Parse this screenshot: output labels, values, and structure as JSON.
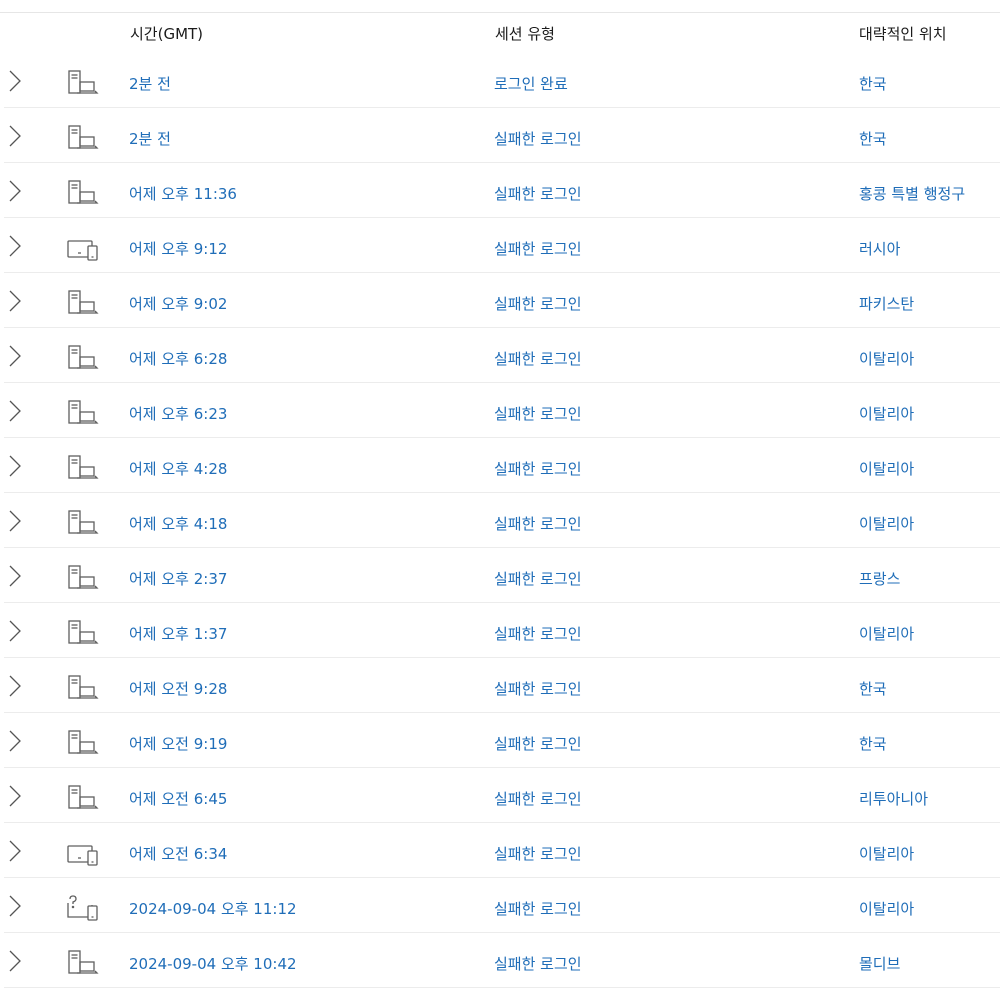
{
  "columns": {
    "time": "시간(GMT)",
    "session_type": "세션 유형",
    "location": "대략적인 위치"
  },
  "colors": {
    "link": "#1f6db8",
    "icon": "#5f5f5f",
    "divider": "#ececec"
  },
  "rows": [
    {
      "device_icon": "desktop-laptop-icon",
      "time": "2분 전",
      "session_type": "로그인 완료",
      "location": "한국"
    },
    {
      "device_icon": "desktop-laptop-icon",
      "time": "2분 전",
      "session_type": "실패한 로그인",
      "location": "한국"
    },
    {
      "device_icon": "desktop-laptop-icon",
      "time": "어제 오후 11:36",
      "session_type": "실패한 로그인",
      "location": "홍콩 특별 행정구"
    },
    {
      "device_icon": "tablet-phone-icon",
      "time": "어제 오후 9:12",
      "session_type": "실패한 로그인",
      "location": "러시아"
    },
    {
      "device_icon": "desktop-laptop-icon",
      "time": "어제 오후 9:02",
      "session_type": "실패한 로그인",
      "location": "파키스탄"
    },
    {
      "device_icon": "desktop-laptop-icon",
      "time": "어제 오후 6:28",
      "session_type": "실패한 로그인",
      "location": "이탈리아"
    },
    {
      "device_icon": "desktop-laptop-icon",
      "time": "어제 오후 6:23",
      "session_type": "실패한 로그인",
      "location": "이탈리아"
    },
    {
      "device_icon": "desktop-laptop-icon",
      "time": "어제 오후 4:28",
      "session_type": "실패한 로그인",
      "location": "이탈리아"
    },
    {
      "device_icon": "desktop-laptop-icon",
      "time": "어제 오후 4:18",
      "session_type": "실패한 로그인",
      "location": "이탈리아"
    },
    {
      "device_icon": "desktop-laptop-icon",
      "time": "어제 오후 2:37",
      "session_type": "실패한 로그인",
      "location": "프랑스"
    },
    {
      "device_icon": "desktop-laptop-icon",
      "time": "어제 오후 1:37",
      "session_type": "실패한 로그인",
      "location": "이탈리아"
    },
    {
      "device_icon": "desktop-laptop-icon",
      "time": "어제 오전 9:28",
      "session_type": "실패한 로그인",
      "location": "한국"
    },
    {
      "device_icon": "desktop-laptop-icon",
      "time": "어제 오전 9:19",
      "session_type": "실패한 로그인",
      "location": "한국"
    },
    {
      "device_icon": "desktop-laptop-icon",
      "time": "어제 오전 6:45",
      "session_type": "실패한 로그인",
      "location": "리투아니아"
    },
    {
      "device_icon": "tablet-phone-icon",
      "time": "어제 오전 6:34",
      "session_type": "실패한 로그인",
      "location": "이탈리아"
    },
    {
      "device_icon": "unknown-device-icon",
      "time": "2024-09-04 오후 11:12",
      "session_type": "실패한 로그인",
      "location": "이탈리아"
    },
    {
      "device_icon": "desktop-laptop-icon",
      "time": "2024-09-04 오후 10:42",
      "session_type": "실패한 로그인",
      "location": "몰디브"
    }
  ]
}
